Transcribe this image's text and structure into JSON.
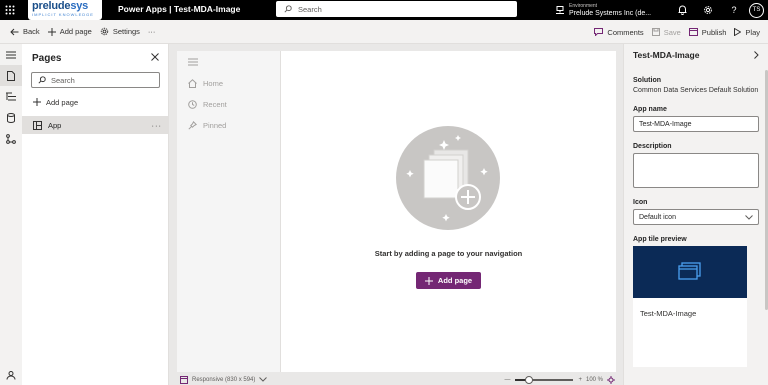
{
  "topbar": {
    "logo_main": "prelude",
    "logo_sys": "sys",
    "logo_tagline": "IMPLICIT KNOWLEDGE",
    "app_title": "Power Apps  |  Test-MDA-Image",
    "search_placeholder": "Search",
    "environment_label": "Environment",
    "environment_name": "Prelude Systems Inc (de...",
    "avatar_initials": "TS"
  },
  "commandbar": {
    "back": "Back",
    "add_page": "Add page",
    "settings": "Settings",
    "more": "···",
    "comments": "Comments",
    "save": "Save",
    "publish": "Publish",
    "play": "Play"
  },
  "pages_panel": {
    "title": "Pages",
    "search_placeholder": "Search",
    "add_page": "Add page",
    "items": [
      {
        "label": "App"
      }
    ]
  },
  "canvas": {
    "nav_items": [
      {
        "label": "Home",
        "icon": "home-icon"
      },
      {
        "label": "Recent",
        "icon": "clock-icon"
      },
      {
        "label": "Pinned",
        "icon": "pin-icon"
      }
    ],
    "empty_message": "Start by adding a page to your navigation",
    "add_button": "Add page",
    "responsive_label": "Responsive (830 x 594)",
    "zoom_percent": "100 %",
    "zoom_level": 0.23
  },
  "properties": {
    "title": "Test-MDA-Image",
    "solution_label": "Solution",
    "solution_value": "Common Data Services Default Solution",
    "app_name_label": "App name",
    "app_name_value": "Test-MDA-Image",
    "description_label": "Description",
    "description_value": "",
    "icon_label": "Icon",
    "icon_value": "Default icon",
    "tile_preview_label": "App tile preview",
    "tile_name": "Test-MDA-Image"
  },
  "colors": {
    "publish_accent": "#742774",
    "tile_background": "#0b2a56"
  }
}
